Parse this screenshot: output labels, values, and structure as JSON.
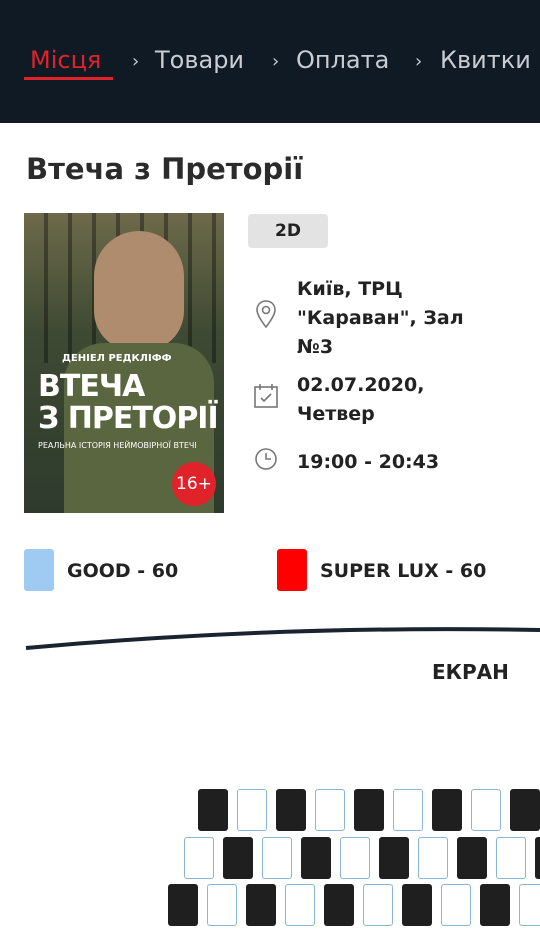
{
  "steps": [
    {
      "label": "Місця",
      "active": true
    },
    {
      "label": "Товари",
      "active": false
    },
    {
      "label": "Оплата",
      "active": false
    },
    {
      "label": "Квитки",
      "active": false
    }
  ],
  "movie": {
    "title": "Втеча з Преторії",
    "format": "2D",
    "poster": {
      "actor": "ДЕНІЕЛ РЕДКЛІФФ",
      "title_line1": "ВТЕЧА",
      "title_line2": "З ПРЕТОРІЇ",
      "tagline": "РЕАЛЬНА ІСТОРІЯ НЕЙМОВІРНОЇ ВТЕЧІ",
      "age_rating": "16+"
    },
    "location_line1": "Київ, ТРЦ",
    "location_line2": "\"Караван\", Зал",
    "location_line3": "№3",
    "date_line1": "02.07.2020,",
    "date_line2": "Четвер",
    "time": "19:00 - 20:43"
  },
  "legend": [
    {
      "label": "GOOD  - 60",
      "color": "#9fcbf2"
    },
    {
      "label": "SUPER LUX  - 60",
      "color": "#ff0000"
    }
  ],
  "screen_label": "ЕКРАН",
  "seat_rows": [
    [
      "taken",
      "free",
      "taken",
      "free",
      "taken",
      "free",
      "taken",
      "free",
      "taken"
    ],
    [
      "free",
      "taken",
      "free",
      "taken",
      "free",
      "taken",
      "free",
      "taken",
      "free",
      "taken"
    ],
    [
      "taken",
      "free",
      "taken",
      "free",
      "taken",
      "free",
      "taken",
      "free",
      "taken",
      "free"
    ]
  ],
  "colors": {
    "accent": "#e0222a",
    "header_bg": "#0f1a24"
  }
}
